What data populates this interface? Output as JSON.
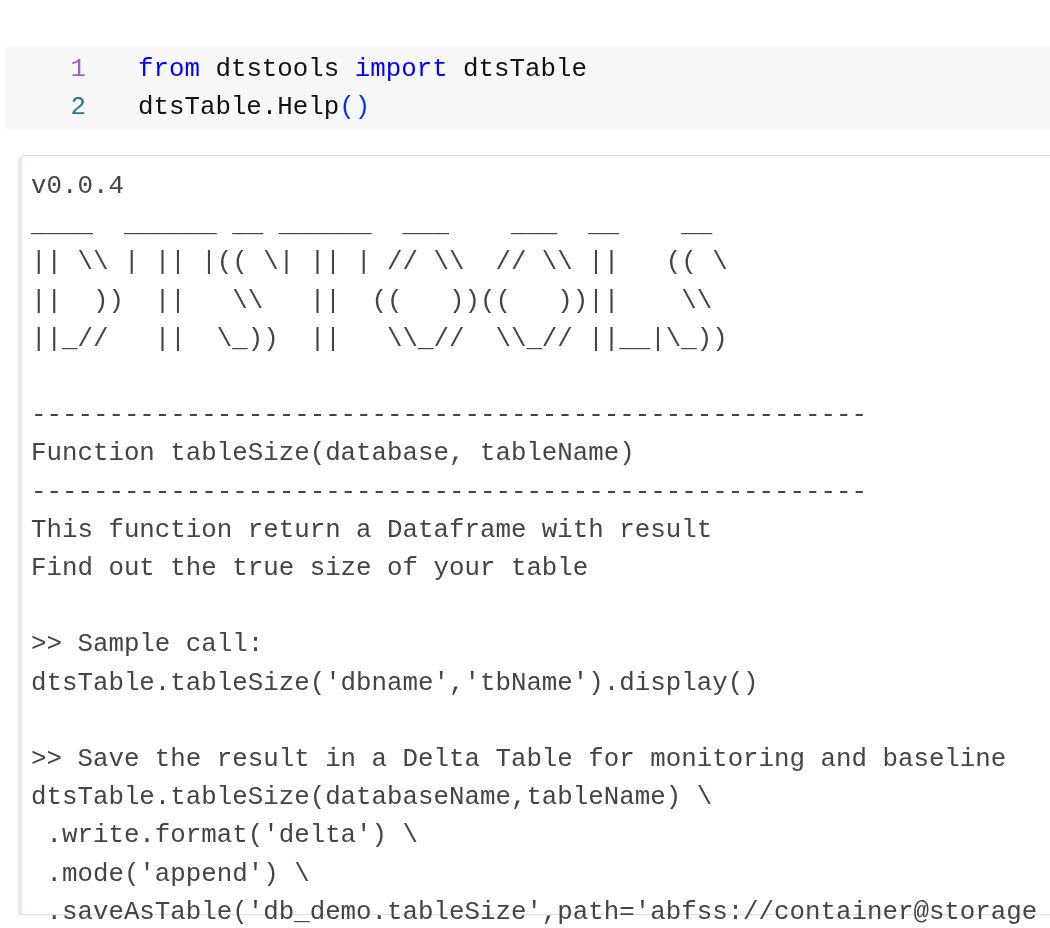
{
  "code_cell": {
    "lines": [
      {
        "number": "1",
        "tokens": [
          {
            "text": "from",
            "kind": "keyword"
          },
          {
            "text": " dtstools ",
            "kind": "plain"
          },
          {
            "text": "import",
            "kind": "keyword"
          },
          {
            "text": " dtsTable",
            "kind": "plain"
          }
        ]
      },
      {
        "number": "2",
        "tokens": [
          {
            "text": "dtsTable.Help",
            "kind": "plain"
          },
          {
            "text": "()",
            "kind": "bracket"
          }
        ]
      }
    ]
  },
  "output": {
    "blocks": [
      {
        "kind": "text",
        "lines": [
          "v0.0.4"
        ]
      },
      {
        "kind": "art",
        "lines": [
          "____  ______ __ ______  ___    ___  __    __",
          "|| \\\\ | || |(( \\| || | // \\\\  // \\\\ ||   (( \\",
          "||  ))  ||   \\\\   ||  ((   ))((   ))||    \\\\",
          "||_//   ||  \\_))  ||   \\\\_//  \\\\_// ||__|\\_))"
        ]
      },
      {
        "kind": "gap"
      },
      {
        "kind": "text",
        "lines": [
          "------------------------------------------------------",
          "Function tableSize(database, tableName)",
          "------------------------------------------------------",
          "This function return a Dataframe with result",
          "Find out the true size of your table"
        ]
      },
      {
        "kind": "gap"
      },
      {
        "kind": "text",
        "lines": [
          ">> Sample call:",
          "dtsTable.tableSize('dbname','tbName').display()"
        ]
      },
      {
        "kind": "gap"
      },
      {
        "kind": "text",
        "lines": [
          ">> Save the result in a Delta Table for monitoring and baseline",
          "dtsTable.tableSize(databaseName,tableName) \\",
          " .write.format('delta') \\",
          " .mode('append') \\",
          " .saveAsTable('db_demo.tableSize',path='abfss://container@storage"
        ]
      }
    ]
  }
}
